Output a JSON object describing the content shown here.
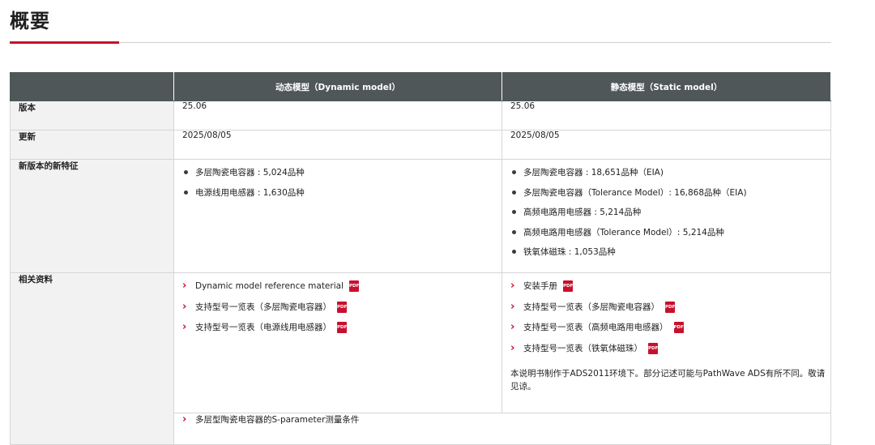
{
  "page": {
    "title": "概要"
  },
  "table": {
    "headers": [
      "",
      "动态模型（Dynamic model）",
      "静态模型（Static model）"
    ],
    "version": {
      "label": "版本",
      "dynamic": "25.06",
      "static": "25.06"
    },
    "update": {
      "label": "更新",
      "dynamic": "2025/08/05",
      "static": "2025/08/05"
    },
    "features": {
      "label": "新版本的新特征",
      "dynamic": [
        "多层陶瓷电容器 : 5,024品种",
        "电源线用电感器 : 1,630品种"
      ],
      "static": [
        "多层陶瓷电容器 : 18,651品种（EIA)",
        "多层陶瓷电容器（Tolerance Model）: 16,868品种（EIA)",
        "高频电路用电感器 : 5,214品种",
        "高频电路用电感器（Tolerance Model）: 5,214品种",
        "铁氧体磁珠 : 1,053品种"
      ]
    },
    "resources": {
      "label": "相关资料",
      "dynamic": [
        "Dynamic model reference material",
        "支持型号一览表（多层陶瓷电容器）",
        "支持型号一览表（电源线用电感器）"
      ],
      "static": [
        "安装手册",
        "支持型号一览表（多层陶瓷电容器）",
        "支持型号一览表（高频电路用电感器）",
        "支持型号一览表（铁氧体磁珠）"
      ],
      "static_note": "本说明书制作于ADS2011环境下。部分记述可能与PathWave ADS有所不同。敬请见谅。",
      "sparam_link": "多层型陶瓷电容器的S-parameter测量条件"
    },
    "pdf_icon_label": "PDF"
  },
  "colors": {
    "accent": "#c8102e",
    "header_bg": "#4f5759",
    "rowhead_bg": "#f2f2f2"
  }
}
